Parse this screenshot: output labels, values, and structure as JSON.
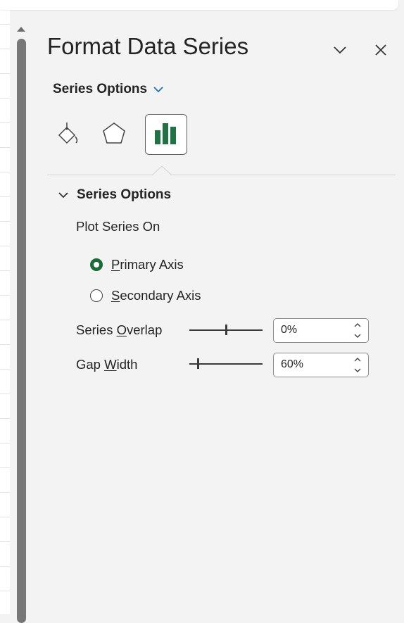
{
  "pane": {
    "title": "Format Data Series",
    "options_dropdown_label": "Series Options",
    "tabs": [
      {
        "name": "Fill & Line",
        "icon": "paint-bucket-icon"
      },
      {
        "name": "Effects",
        "icon": "pentagon-icon"
      },
      {
        "name": "Series Options",
        "icon": "bar-chart-icon",
        "selected": true
      }
    ]
  },
  "series_options": {
    "header": "Series Options",
    "plot_series_on": "Plot Series On",
    "primary_axis": {
      "prefix": "",
      "accel": "P",
      "rest": "rimary Axis",
      "selected": true
    },
    "secondary_axis": {
      "prefix": "",
      "accel": "S",
      "rest": "econdary Axis",
      "selected": false
    },
    "series_overlap": {
      "prefix": "Series ",
      "accel": "O",
      "rest": "verlap",
      "value": "0%",
      "slider_fraction": 0.5
    },
    "gap_width": {
      "prefix": "Gap ",
      "accel": "W",
      "rest": "idth",
      "value": "60%",
      "slider_fraction": 0.12
    }
  },
  "colors": {
    "accent_green": "#1b6b3a",
    "chart_icon_green": "#217346",
    "dropdown_blue": "#1f6fc2"
  }
}
